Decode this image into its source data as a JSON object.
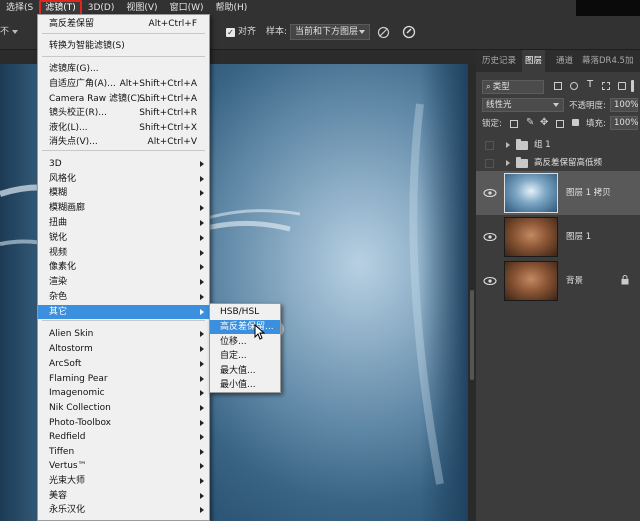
{
  "menubar": {
    "items": [
      "选择(S",
      "滤镜(T)",
      "3D(D)",
      "视图(V)",
      "窗口(W)",
      "帮助(H)"
    ],
    "active_index": 1
  },
  "options_bar": {
    "left_fragment": "不",
    "align_label": "对齐",
    "sample_label": "样本:",
    "sample_value": "当前和下方图层"
  },
  "filter_menu": {
    "items": [
      {
        "label": "高反差保留",
        "shortcut": "Alt+Ctrl+F"
      },
      {
        "label": "转换为智能滤镜(S)",
        "shortcut": ""
      },
      {
        "label": "滤镜库(G)...",
        "shortcut": ""
      },
      {
        "label": "自适应广角(A)...",
        "shortcut": "Alt+Shift+Ctrl+A"
      },
      {
        "label": "Camera Raw 滤镜(C)...",
        "shortcut": "Shift+Ctrl+A"
      },
      {
        "label": "镜头校正(R)...",
        "shortcut": "Shift+Ctrl+R"
      },
      {
        "label": "液化(L)...",
        "shortcut": "Shift+Ctrl+X"
      },
      {
        "label": "消失点(V)...",
        "shortcut": "Alt+Ctrl+V"
      },
      {
        "label": "3D",
        "shortcut": ""
      },
      {
        "label": "风格化",
        "shortcut": ""
      },
      {
        "label": "模糊",
        "shortcut": ""
      },
      {
        "label": "模糊画廊",
        "shortcut": ""
      },
      {
        "label": "扭曲",
        "shortcut": ""
      },
      {
        "label": "锐化",
        "shortcut": ""
      },
      {
        "label": "视频",
        "shortcut": ""
      },
      {
        "label": "像素化",
        "shortcut": ""
      },
      {
        "label": "渲染",
        "shortcut": ""
      },
      {
        "label": "杂色",
        "shortcut": ""
      },
      {
        "label": "其它",
        "shortcut": ""
      },
      {
        "label": "Alien Skin",
        "shortcut": ""
      },
      {
        "label": "Altostorm",
        "shortcut": ""
      },
      {
        "label": "ArcSoft",
        "shortcut": ""
      },
      {
        "label": "Flaming Pear",
        "shortcut": ""
      },
      {
        "label": "Imagenomic",
        "shortcut": ""
      },
      {
        "label": "Nik Collection",
        "shortcut": ""
      },
      {
        "label": "Photo-Toolbox",
        "shortcut": ""
      },
      {
        "label": "Redfield",
        "shortcut": ""
      },
      {
        "label": "Tiffen",
        "shortcut": ""
      },
      {
        "label": "Vertus™",
        "shortcut": ""
      },
      {
        "label": "光束大师",
        "shortcut": ""
      },
      {
        "label": "美容",
        "shortcut": ""
      },
      {
        "label": "永乐汉化",
        "shortcut": ""
      }
    ]
  },
  "submenu": {
    "items": [
      "HSB/HSL",
      "高反差保留...",
      "位移...",
      "自定...",
      "最大值...",
      "最小值..."
    ],
    "active_index": 1
  },
  "panel": {
    "tabs": [
      "历史记录",
      "图层",
      "通道",
      "幕落DR4.5加"
    ],
    "active_tab": 1,
    "kind_filter": "类型",
    "blend_mode": "线性光",
    "opacity_label": "不透明度:",
    "opacity_value": "100%",
    "lock_label": "锁定:",
    "fill_label": "填充:",
    "fill_value": "100%",
    "groups": [
      "组 1",
      "高反差保留高低频"
    ],
    "layers": [
      "图层 1 拷贝",
      "图层 1",
      "背景"
    ]
  },
  "colors": {
    "menu_highlight": "#3a8fde",
    "active_menu_outline": "#e0261d"
  }
}
